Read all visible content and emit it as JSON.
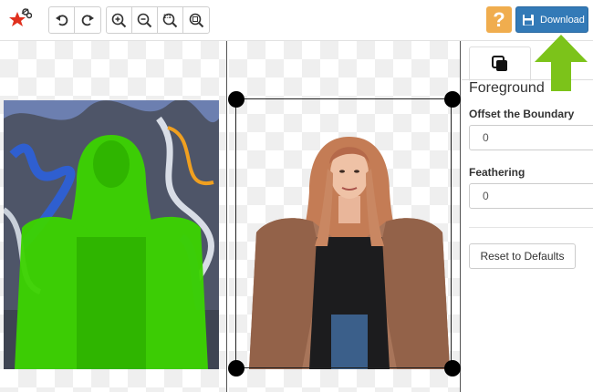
{
  "toolbar": {
    "undo_icon": "undo-icon",
    "redo_icon": "redo-icon",
    "zoom_in_icon": "zoom-in-icon",
    "zoom_out_icon": "zoom-out-icon",
    "zoom_actual_label": "1:1",
    "zoom_fit_icon": "zoom-fit-icon",
    "help_label": "?",
    "download_label": "Download"
  },
  "side_panel": {
    "tab_icon": "layers-icon",
    "title": "Foreground",
    "offset_label": "Offset the Boundary",
    "offset_value": "0",
    "feathering_label": "Feathering",
    "feathering_value": "0",
    "reset_label": "Reset to Defaults"
  },
  "colors": {
    "accent": "#337ab7",
    "help": "#f0ad4e",
    "mask": "#39d000",
    "hint_arrow": "#7cc31a"
  }
}
